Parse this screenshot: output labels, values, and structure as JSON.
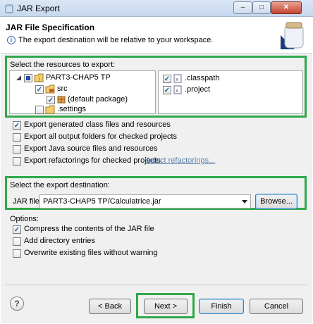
{
  "window": {
    "title": "JAR Export",
    "minimize": "–",
    "maximize": "□",
    "close": "✕"
  },
  "header": {
    "title": "JAR File Specification",
    "description": "The export destination will be relative to your workspace.",
    "info_glyph": "i"
  },
  "resources": {
    "label": "Select the resources to export:",
    "tree": [
      {
        "label": "PART3-CHAP5 TP",
        "icon": "project-icon",
        "state": "partial"
      },
      {
        "label": "src",
        "icon": "source-folder-icon",
        "state": "checked"
      },
      {
        "label": "(default package)",
        "icon": "package-icon",
        "state": "checked"
      },
      {
        "label": ".settings",
        "icon": "folder-icon",
        "state": "unchecked"
      }
    ],
    "files": [
      {
        "label": ".classpath",
        "state": "checked"
      },
      {
        "label": ".project",
        "state": "checked"
      }
    ]
  },
  "options_top": [
    {
      "label": "Export generated class files and resources",
      "checked": true
    },
    {
      "label": "Export all output folders for checked projects",
      "checked": false
    },
    {
      "label": "Export Java source files and resources",
      "checked": false
    },
    {
      "label": "Export refactorings for checked projects.",
      "checked": false
    }
  ],
  "select_refactorings": "Select refactorings...",
  "destination": {
    "label": "Select the export destination:",
    "jar_label": "JAR file:",
    "jar_value": "PART3-CHAP5 TP/Calculatrice.jar",
    "browse": "Browse..."
  },
  "options": {
    "label": "Options:",
    "items": [
      {
        "label": "Compress the contents of the JAR file",
        "checked": true
      },
      {
        "label": "Add directory entries",
        "checked": false
      },
      {
        "label": "Overwrite existing files without warning",
        "checked": false
      }
    ]
  },
  "buttons": {
    "help": "?",
    "back": "< Back",
    "next": "Next >",
    "finish": "Finish",
    "cancel": "Cancel"
  },
  "colors": {
    "highlight": "#2fa84a",
    "link": "#5c7fa8",
    "check": "#1d5a99"
  }
}
